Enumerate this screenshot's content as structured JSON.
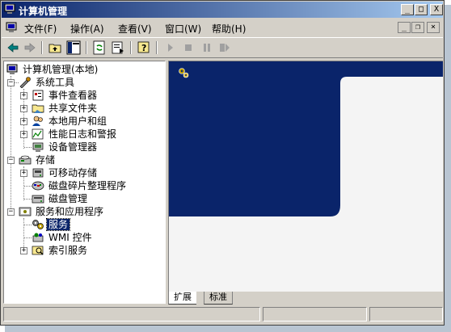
{
  "window": {
    "title": "计算机管理",
    "buttons": {
      "minimize": "_",
      "maximize": "□",
      "close": "X"
    }
  },
  "menu": {
    "items": [
      {
        "label": "文件(F)"
      },
      {
        "label": "操作(A)"
      },
      {
        "label": "查看(V)"
      },
      {
        "label": "窗口(W)"
      },
      {
        "label": "帮助(H)"
      }
    ],
    "mdi": {
      "minimize": "_",
      "restore": "❐",
      "close": "×"
    }
  },
  "tree": {
    "root": "计算机管理(本地)",
    "system_tools": "系统工具",
    "event_viewer": "事件查看器",
    "shared_folders": "共享文件夹",
    "local_users": "本地用户和组",
    "perf_logs": "性能日志和警报",
    "device_manager": "设备管理器",
    "storage": "存储",
    "removable_storage": "可移动存储",
    "defrag": "磁盘碎片整理程序",
    "disk_mgmt": "磁盘管理",
    "services_apps": "服务和应用程序",
    "services": "服务",
    "wmi": "WMI 控件",
    "indexing": "索引服务"
  },
  "tabs": {
    "extended": "扩展",
    "standard": "标准"
  },
  "colors": {
    "title_start": "#0a246a",
    "title_end": "#a6caf0",
    "detail_banner": "#0a246a",
    "face": "#d4d0c8"
  },
  "icons": [
    "computer-icon",
    "back-icon",
    "forward-icon",
    "up-folder-icon",
    "show-tree-icon",
    "refresh-icon",
    "export-icon",
    "help-icon",
    "play-icon",
    "stop-icon",
    "pause-icon",
    "restart-icon",
    "gears-icon"
  ]
}
